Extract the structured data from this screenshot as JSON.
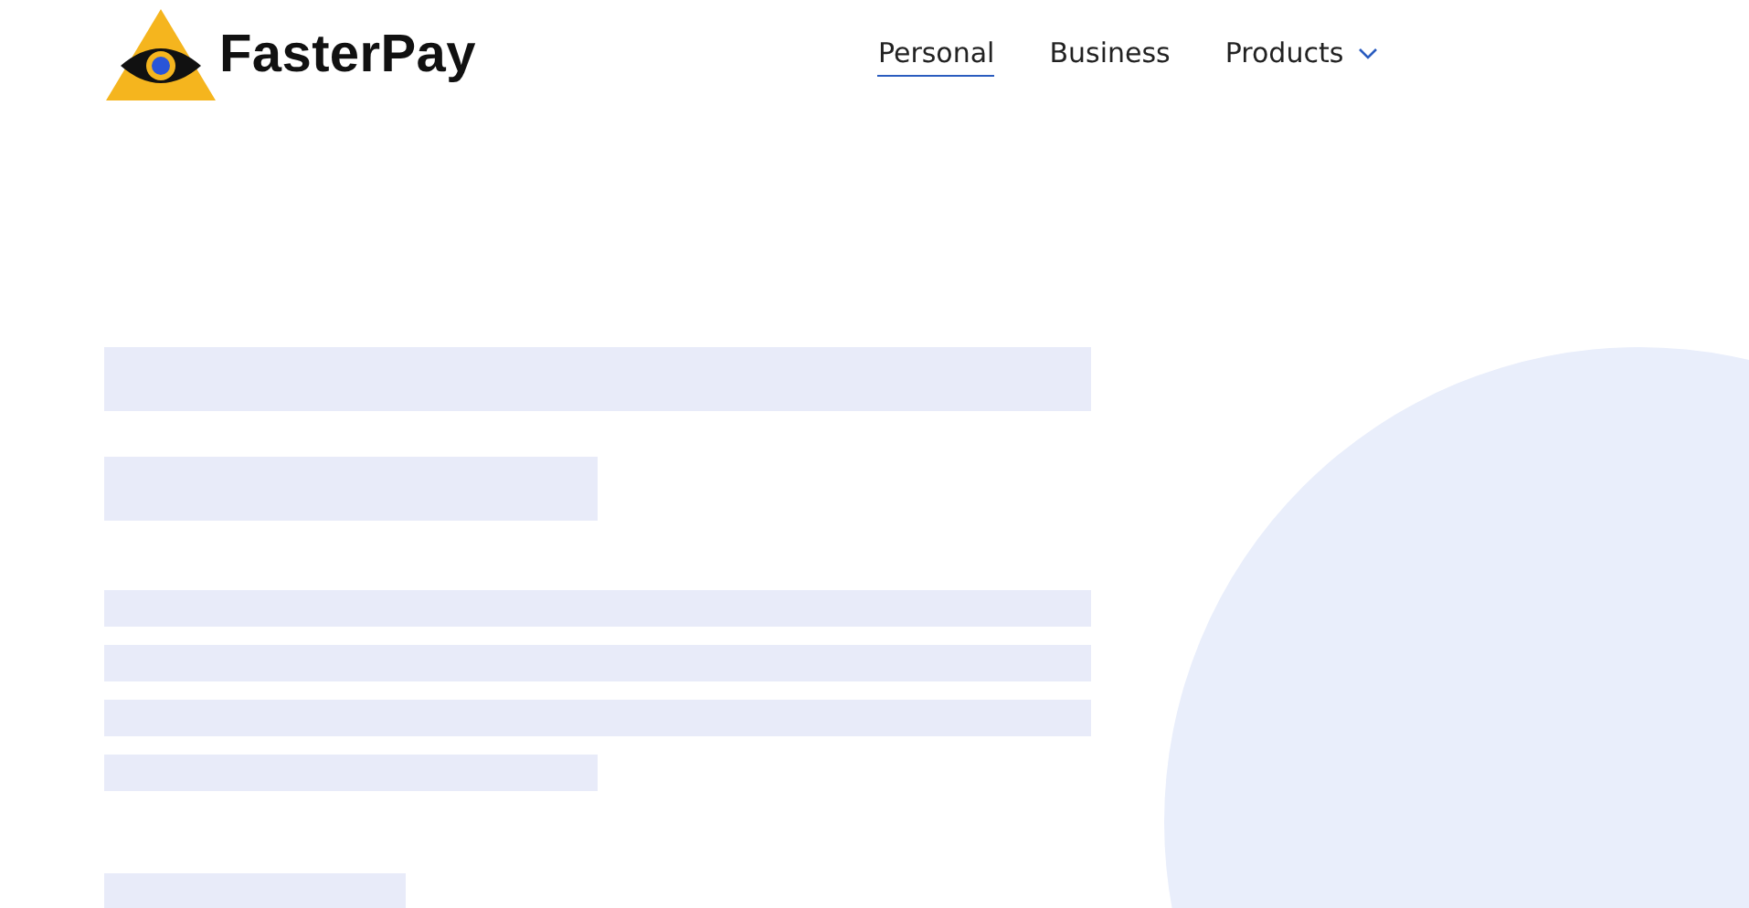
{
  "header": {
    "brand": "FasterPay",
    "nav": [
      {
        "label": "Personal",
        "selected": true,
        "dropdown": false
      },
      {
        "label": "Business",
        "selected": false,
        "dropdown": false
      },
      {
        "label": "Products",
        "selected": false,
        "dropdown": true
      }
    ]
  },
  "placeholders": [
    {
      "kind": "title"
    },
    {
      "kind": "subtitle"
    },
    {
      "kind": "line"
    },
    {
      "kind": "line"
    },
    {
      "kind": "line"
    },
    {
      "kind": "short-line"
    },
    {
      "kind": "button"
    }
  ]
}
